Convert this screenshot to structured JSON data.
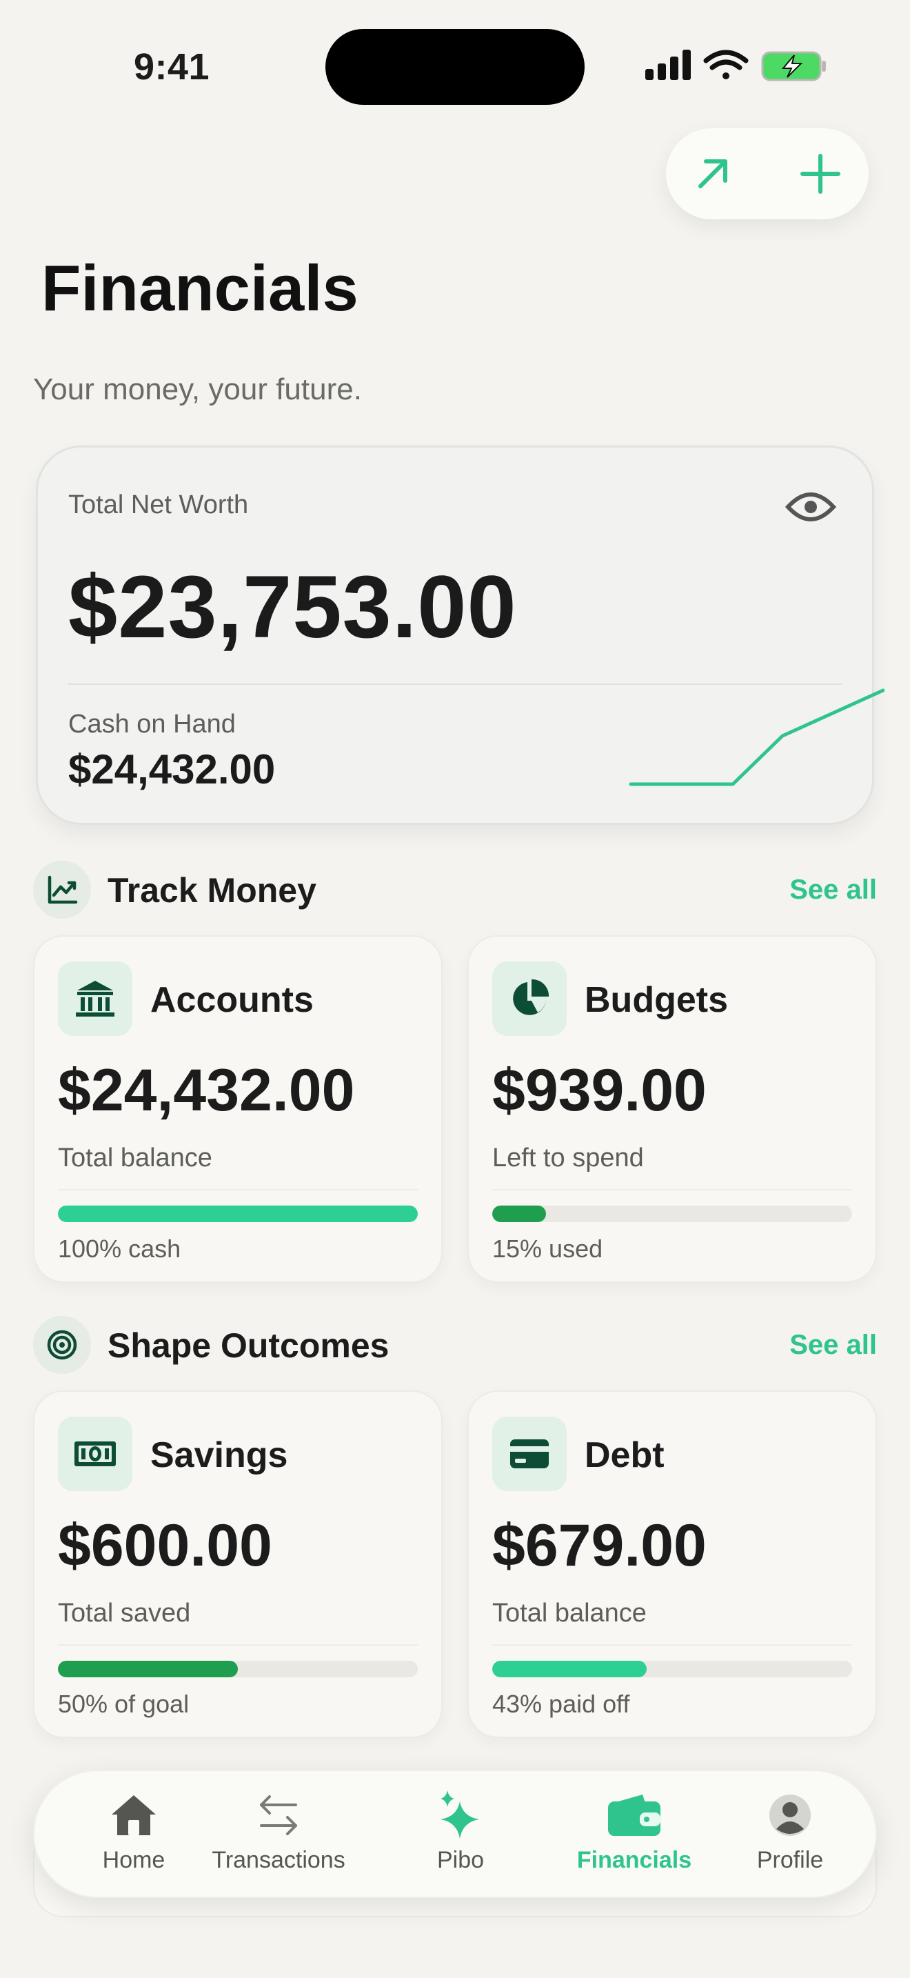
{
  "status_bar": {
    "time": "9:41"
  },
  "page": {
    "title": "Financials",
    "subtitle": "Your money, your future."
  },
  "net_worth": {
    "label": "Total Net Worth",
    "value": "$23,753.00",
    "cash_label": "Cash on Hand",
    "cash_value": "$24,432.00"
  },
  "track_money": {
    "title": "Track Money",
    "see_all": "See all",
    "accounts": {
      "title": "Accounts",
      "value": "$24,432.00",
      "subtitle": "Total balance",
      "progress": 1.0,
      "footer": "100% cash",
      "color": "#2ecf93"
    },
    "budgets": {
      "title": "Budgets",
      "value": "$939.00",
      "subtitle": "Left to spend",
      "progress": 0.15,
      "footer": "15% used",
      "color": "#1f9e4f"
    }
  },
  "shape_outcomes": {
    "title": "Shape Outcomes",
    "see_all": "See all",
    "savings": {
      "title": "Savings",
      "value": "$600.00",
      "subtitle": "Total saved",
      "progress": 0.5,
      "footer": "50% of goal",
      "color": "#1f9e4f"
    },
    "debt": {
      "title": "Debt",
      "value": "$679.00",
      "subtitle": "Total balance",
      "progress": 0.43,
      "footer": "43% paid off",
      "color": "#2ecf93"
    }
  },
  "tabbar": {
    "items": [
      {
        "label": "Home",
        "icon": "house-icon"
      },
      {
        "label": "Transactions",
        "icon": "arrows-swap-icon"
      },
      {
        "label": "Pibo",
        "icon": "sparkles-icon"
      },
      {
        "label": "Financials",
        "icon": "wallet-icon",
        "active": true
      },
      {
        "label": "Profile",
        "icon": "person-icon"
      }
    ]
  },
  "colors": {
    "accent": "#2fc48e",
    "dark_green": "#0e4d35",
    "background": "#f4f3ef"
  }
}
